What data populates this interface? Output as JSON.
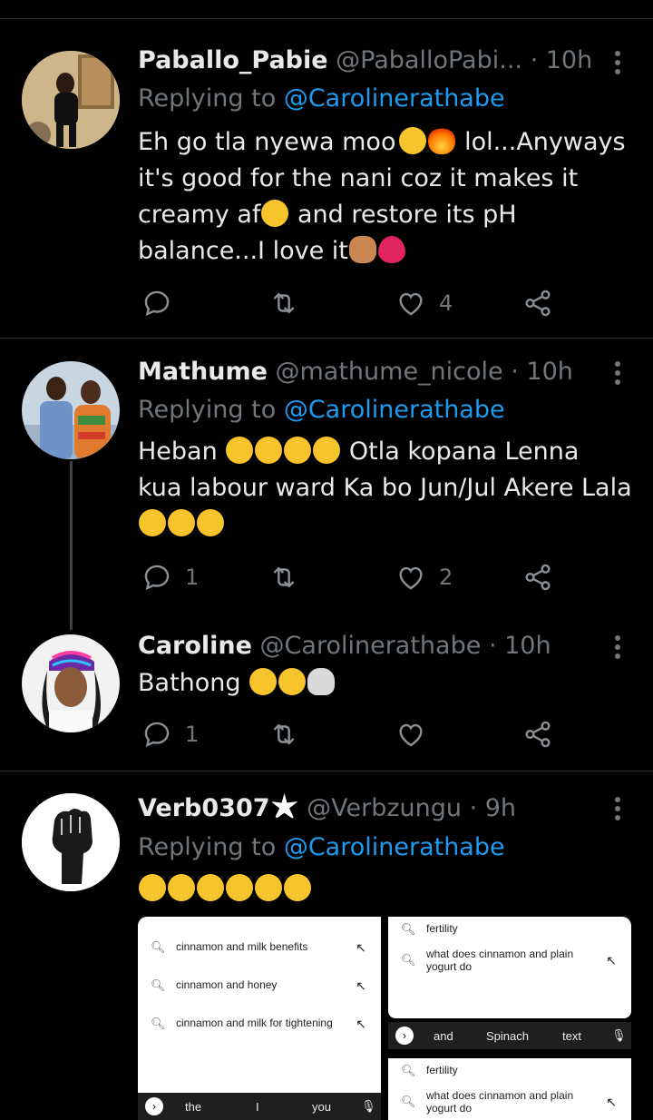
{
  "tweets": [
    {
      "name": "Paballo_Pabie",
      "handle": "@PaballoPabi...",
      "time": "· 10h",
      "replying_prefix": "Replying to ",
      "replying_to": "@Carolinerathabe",
      "text_lines": [
        "Eh go tla nyewa moo",
        "lol...Anyways",
        "it's good for the nani coz it makes it",
        "creamy af",
        "and restore its pH",
        "balance...I love it"
      ],
      "replies": "",
      "retweets": "",
      "likes": "4"
    },
    {
      "name": "Mathume",
      "handle": "@mathume_nicole",
      "time": "· 10h",
      "replying_prefix": "Replying to ",
      "replying_to": "@Carolinerathabe",
      "text_lines": [
        "Heban",
        "Otla kopana Lenna",
        "kua labour ward Ka bo Jun/Jul Akere Lala"
      ],
      "replies": "1",
      "retweets": "",
      "likes": "2"
    },
    {
      "name": "Caroline",
      "handle": "@Carolinerathabe",
      "time": "· 10h",
      "text_lines": [
        "Bathong"
      ],
      "replies": "1",
      "retweets": "",
      "likes": ""
    },
    {
      "name": "Verb0307",
      "handle": "@Verbzungu",
      "time": "· 9h",
      "replying_prefix": "Replying to ",
      "replying_to": "@Carolinerathabe"
    }
  ],
  "screenshot_left": {
    "suggestions": [
      "cinnamon and milk benefits",
      "cinnamon and honey",
      "cinnamon and milk for tightening"
    ],
    "keyboard": [
      "the",
      "I",
      "you"
    ]
  },
  "screenshot_right_top": {
    "top_text": "fertility",
    "suggestion_line1": "what does cinnamon and plain",
    "suggestion_line2": "yogurt do",
    "keyboard": [
      "and",
      "Spinach",
      "text"
    ]
  },
  "screenshot_right_bottom": {
    "top_text": "fertility",
    "suggestion_line1": "what does cinnamon and plain",
    "suggestion_line2": "yogurt do"
  },
  "colors": {
    "background": "#000000",
    "text": "#e7e9ea",
    "muted": "#71767b",
    "link": "#1d9bf0",
    "divider": "#2f3336"
  },
  "icons": [
    "reply-icon",
    "retweet-icon",
    "like-icon",
    "share-icon",
    "more-icon",
    "search-icon",
    "arrow-icon",
    "mic-icon"
  ]
}
